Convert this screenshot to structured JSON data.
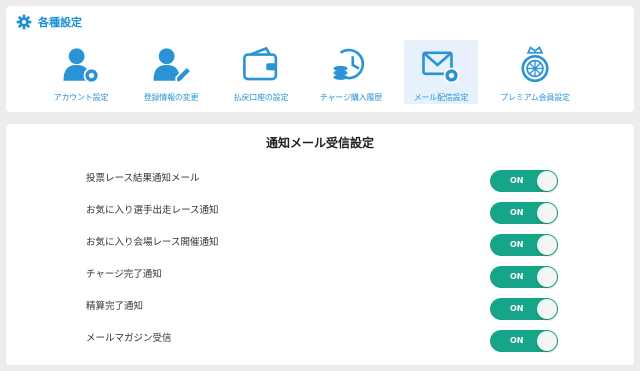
{
  "header": {
    "title": "各種設定",
    "icon": "gear-icon",
    "accent": "#1b8fd4"
  },
  "nav": {
    "items": [
      {
        "label": "アカウント設定",
        "icon": "user-gear-icon",
        "active": false
      },
      {
        "label": "登録情報の変更",
        "icon": "user-edit-icon",
        "active": false
      },
      {
        "label": "払戻口座の設定",
        "icon": "wallet-icon",
        "active": false
      },
      {
        "label": "チャージ購入履歴",
        "icon": "history-coins-icon",
        "active": false
      },
      {
        "label": "メール配信設定",
        "icon": "mail-gear-icon",
        "active": true
      },
      {
        "label": "プレミアム会員設定",
        "icon": "premium-badge-icon",
        "active": false
      }
    ]
  },
  "main": {
    "title": "通知メール受信設定",
    "toggle_color": "#17a589",
    "settings": [
      {
        "label": "投票レース結果通知メール",
        "state": "ON"
      },
      {
        "label": "お気に入り選手出走レース通知",
        "state": "ON"
      },
      {
        "label": "お気に入り会場レース開催通知",
        "state": "ON"
      },
      {
        "label": "チャージ完了通知",
        "state": "ON"
      },
      {
        "label": "精算完了通知",
        "state": "ON"
      },
      {
        "label": "メールマガジン受信",
        "state": "ON"
      }
    ]
  }
}
